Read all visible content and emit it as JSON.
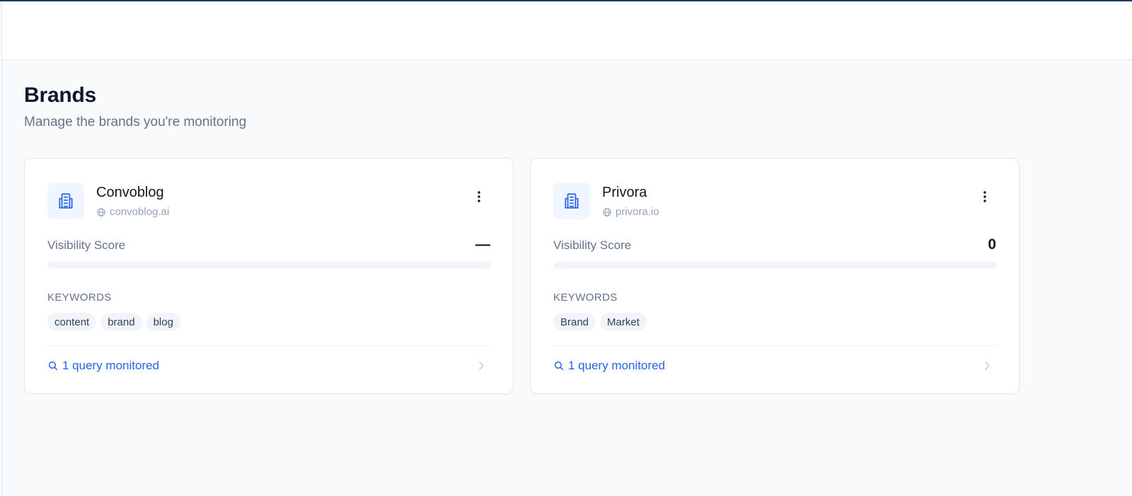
{
  "page": {
    "title": "Brands",
    "subtitle": "Manage the brands you're monitoring"
  },
  "colors": {
    "accent": "#2563eb",
    "icon_bg": "#eff6ff",
    "chip_bg": "#f1f5f9",
    "text_muted": "#64748b",
    "top_accent": "#1e3a5f"
  },
  "brands": [
    {
      "name": "Convoblog",
      "domain": "convoblog.ai",
      "icon": "building-icon",
      "score_label": "Visibility Score",
      "score": "—",
      "score_fraction": 0,
      "keywords_label": "KEYWORDS",
      "keywords": [
        "content",
        "brand",
        "blog"
      ],
      "queries_label": "1 query monitored"
    },
    {
      "name": "Privora",
      "domain": "privora.io",
      "icon": "building-icon",
      "score_label": "Visibility Score",
      "score": "0",
      "score_fraction": 0,
      "keywords_label": "KEYWORDS",
      "keywords": [
        "Brand",
        "Market"
      ],
      "queries_label": "1 query monitored"
    }
  ]
}
